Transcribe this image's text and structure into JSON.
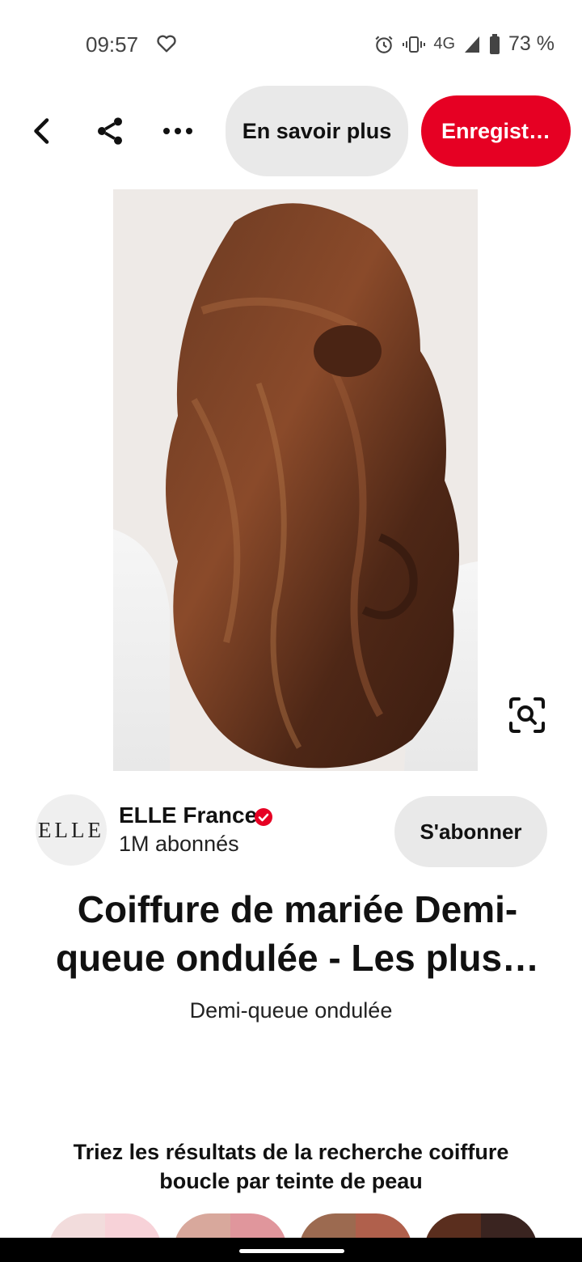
{
  "status_bar": {
    "time": "09:57",
    "network": "4G",
    "battery": "73 %"
  },
  "top_bar": {
    "learn_more_label": "En savoir plus",
    "save_label": "Enregist…",
    "save_color": "#e60023"
  },
  "creator": {
    "avatar_text": "ELLE",
    "name": "ELLE France",
    "followers": "1M abonnés",
    "follow_label": "S'abonner",
    "verified_color": "#e60023"
  },
  "pin": {
    "title": "Coiffure de mariée Demi-queue ondulée - Les plus…",
    "description": "Demi-queue ondulée"
  },
  "skin_tone": {
    "heading": "Triez les résultats de la recherche coiffure boucle par teinte de peau",
    "swatches": [
      {
        "name": "light",
        "colors": [
          "#f2dcdc",
          "#f7d2d8"
        ]
      },
      {
        "name": "medium-light",
        "colors": [
          "#d8a89c",
          "#e0969c"
        ]
      },
      {
        "name": "medium-dark",
        "colors": [
          "#9c6a50",
          "#b0604c"
        ]
      },
      {
        "name": "dark",
        "colors": [
          "#5a2e1e",
          "#3a2420"
        ]
      }
    ]
  },
  "icons": {
    "back": "chevron-left-icon",
    "share": "share-icon",
    "more": "more-dots-icon",
    "visual_search": "visual-search-icon",
    "verified": "verified-badge-icon"
  }
}
